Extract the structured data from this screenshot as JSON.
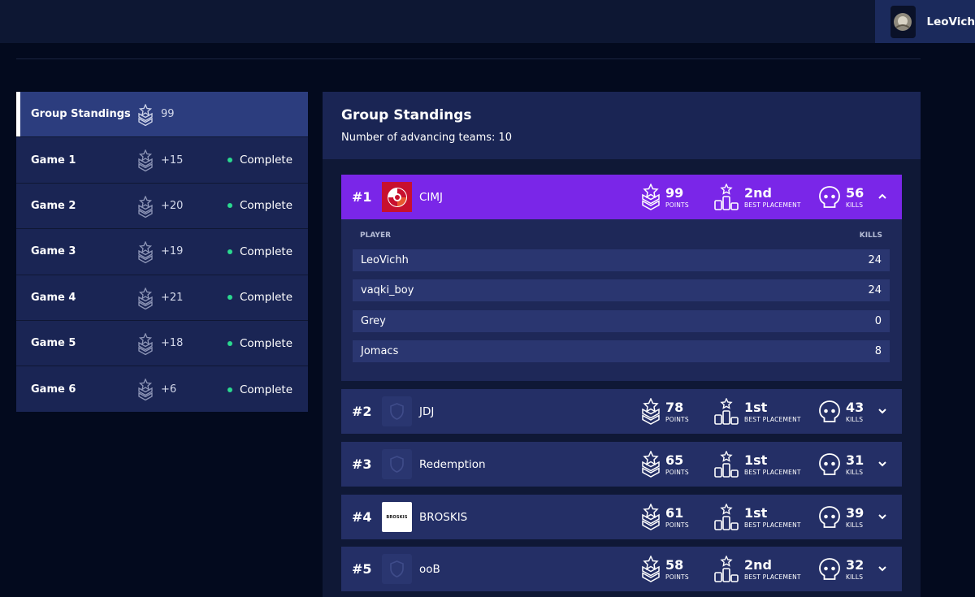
{
  "user": {
    "name": "LeoVich"
  },
  "sidebar": {
    "items": [
      {
        "label": "Group Standings",
        "points": "99",
        "status": ""
      },
      {
        "label": "Game 1",
        "points": "+15",
        "status": "Complete"
      },
      {
        "label": "Game 2",
        "points": "+20",
        "status": "Complete"
      },
      {
        "label": "Game 3",
        "points": "+19",
        "status": "Complete"
      },
      {
        "label": "Game 4",
        "points": "+21",
        "status": "Complete"
      },
      {
        "label": "Game 5",
        "points": "+18",
        "status": "Complete"
      },
      {
        "label": "Game 6",
        "points": "+6",
        "status": "Complete"
      }
    ]
  },
  "main": {
    "title": "Group Standings",
    "advancing": "Number of advancing teams: 10",
    "captions": {
      "points": "POINTS",
      "placement": "BEST PLACEMENT",
      "kills": "KILLS"
    },
    "player_header": {
      "player": "PLAYER",
      "kills": "KILLS"
    },
    "teams": [
      {
        "rank": "#1",
        "name": "CIMJ",
        "points": "99",
        "placement": "2nd",
        "kills": "56",
        "logo": "cimj-logo",
        "expanded": true
      },
      {
        "rank": "#2",
        "name": "JDJ",
        "points": "78",
        "placement": "1st",
        "kills": "43",
        "logo": "placeholder-shield-logo",
        "expanded": false
      },
      {
        "rank": "#3",
        "name": "Redemption",
        "points": "65",
        "placement": "1st",
        "kills": "31",
        "logo": "placeholder-shield-logo",
        "expanded": false
      },
      {
        "rank": "#4",
        "name": "BROSKIS",
        "points": "61",
        "placement": "1st",
        "kills": "39",
        "logo": "broskis-logo",
        "logo_text": "BROSKIS",
        "expanded": false
      },
      {
        "rank": "#5",
        "name": "ooB",
        "points": "58",
        "placement": "2nd",
        "kills": "32",
        "logo": "placeholder-shield-logo",
        "expanded": false
      }
    ],
    "players": [
      {
        "name": "LeoVichh",
        "kills": "24"
      },
      {
        "name": "vaqki_boy",
        "kills": "24"
      },
      {
        "name": "Grey",
        "kills": "0"
      },
      {
        "name": "Jomacs",
        "kills": "8"
      }
    ]
  },
  "colors": {
    "background": "#030a1e",
    "panel": "#1a2554",
    "active_item": "#2c3d7e",
    "expanded_team": "#7a26e8",
    "team_row": "#242f66",
    "status_complete": "#2ad98f"
  }
}
